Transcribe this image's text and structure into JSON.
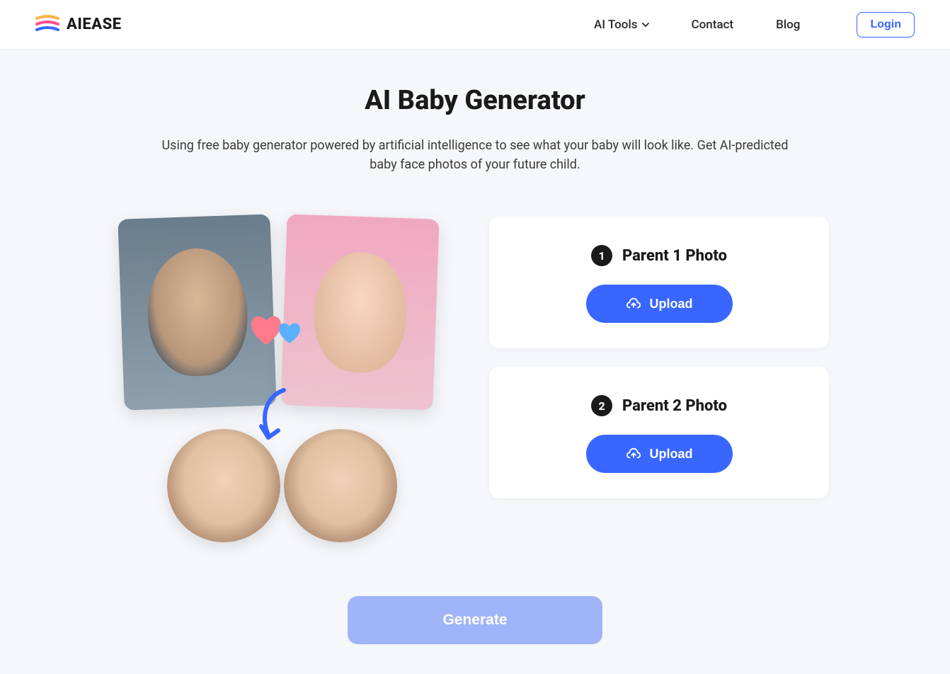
{
  "brand": {
    "name": "AIEASE"
  },
  "nav": {
    "items": [
      {
        "label": "AI Tools",
        "hasDropdown": true
      },
      {
        "label": "Contact",
        "hasDropdown": false
      },
      {
        "label": "Blog",
        "hasDropdown": false
      }
    ],
    "login_label": "Login"
  },
  "hero": {
    "title": "AI Baby Generator",
    "subtitle": "Using free baby generator powered by artificial intelligence to see what your baby will look like. Get AI-predicted baby face photos of your future child."
  },
  "upload_cards": [
    {
      "step": "1",
      "title": "Parent 1 Photo",
      "button_label": "Upload"
    },
    {
      "step": "2",
      "title": "Parent 2 Photo",
      "button_label": "Upload"
    }
  ],
  "generate_label": "Generate",
  "colors": {
    "primary": "#3866ff",
    "primary_disabled": "#a0b4fa",
    "text": "#1a1a1a",
    "bg": "#f6f7fa"
  }
}
